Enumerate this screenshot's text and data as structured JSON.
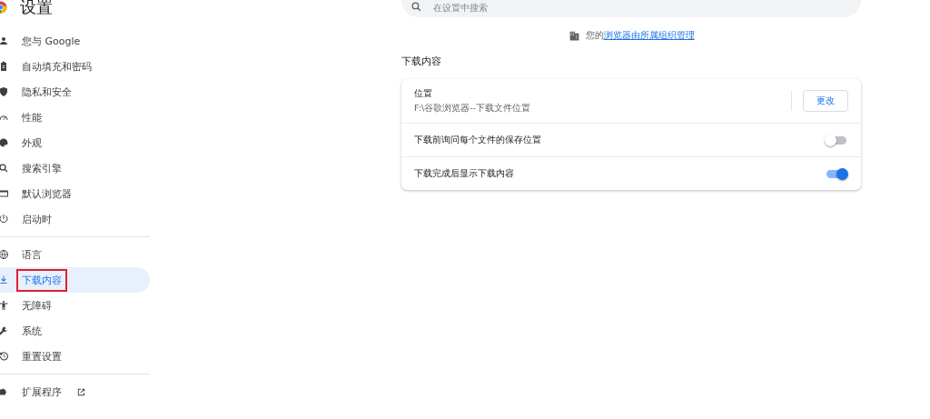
{
  "header": {
    "title": "设置"
  },
  "sidebar": {
    "items": [
      {
        "label": "您与 Google",
        "selected": false,
        "highlighted": false
      },
      {
        "label": "自动填充和密码",
        "selected": false,
        "highlighted": false
      },
      {
        "label": "隐私和安全",
        "selected": false,
        "highlighted": false
      },
      {
        "label": "性能",
        "selected": false,
        "highlighted": false
      },
      {
        "label": "外观",
        "selected": false,
        "highlighted": false
      },
      {
        "label": "搜索引擎",
        "selected": false,
        "highlighted": false
      },
      {
        "label": "默认浏览器",
        "selected": false,
        "highlighted": false
      },
      {
        "label": "启动时",
        "selected": false,
        "highlighted": false
      },
      {
        "label": "语言",
        "selected": false,
        "highlighted": false,
        "divider_before": true
      },
      {
        "label": "下载内容",
        "selected": true,
        "highlighted": true
      },
      {
        "label": "无障碍",
        "selected": false,
        "highlighted": false
      },
      {
        "label": "系统",
        "selected": false,
        "highlighted": false
      },
      {
        "label": "重置设置",
        "selected": false,
        "highlighted": false
      },
      {
        "label": "扩展程序",
        "selected": false,
        "highlighted": false,
        "divider_before": true,
        "external": true
      }
    ]
  },
  "search": {
    "placeholder": "在设置中搜索"
  },
  "managed_notice": {
    "prefix": "您的",
    "link": "浏览器由所属组织管理"
  },
  "section": {
    "title": "下载内容",
    "rows": [
      {
        "kind": "location",
        "label": "位置",
        "value": "F:\\谷歌浏览器--下载文件位置",
        "button": "更改"
      },
      {
        "kind": "toggle",
        "label": "下载前询问每个文件的保存位置",
        "on": false
      },
      {
        "kind": "toggle",
        "label": "下载完成后显示下载内容",
        "on": true
      }
    ]
  }
}
